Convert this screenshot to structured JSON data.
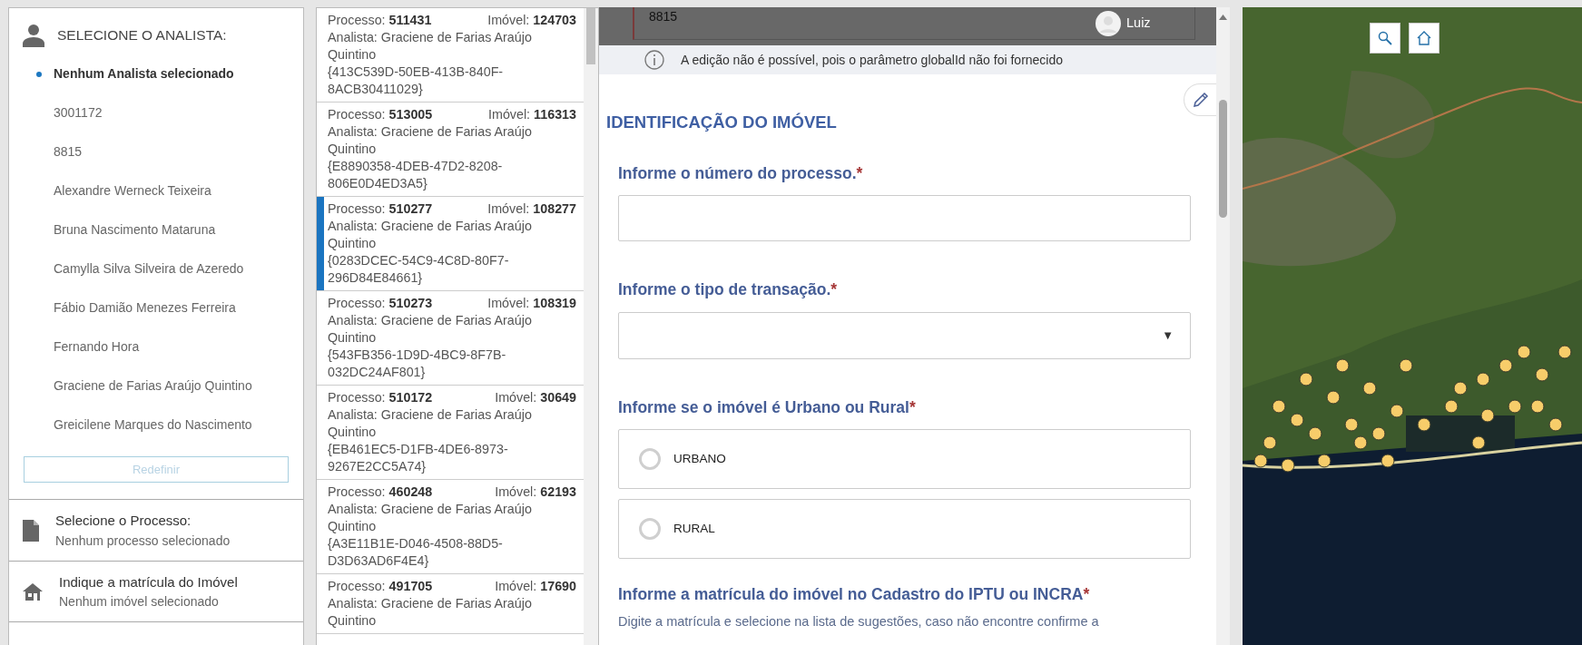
{
  "analyst_panel": {
    "title": "SELECIONE O ANALISTA:",
    "options": [
      {
        "label": "Nenhum Analista selecionado",
        "selected": true
      },
      {
        "label": "3001172",
        "selected": false
      },
      {
        "label": "8815",
        "selected": false
      },
      {
        "label": "Alexandre Werneck Teixeira",
        "selected": false
      },
      {
        "label": "Bruna Nascimento Mataruna",
        "selected": false
      },
      {
        "label": "Camylla Silva Silveira de Azeredo",
        "selected": false
      },
      {
        "label": "Fábio Damião Menezes Ferreira",
        "selected": false
      },
      {
        "label": "Fernando Hora",
        "selected": false
      },
      {
        "label": "Graciene de Farias Araújo Quintino",
        "selected": false
      },
      {
        "label": "Greicilene Marques do Nascimento",
        "selected": false
      }
    ],
    "reset_button": {
      "label": "Redefinir",
      "disabled": true
    }
  },
  "steps": [
    {
      "kind": "document",
      "title": "Selecione o Processo:",
      "subtitle": "Nenhum processo selecionado"
    },
    {
      "kind": "house",
      "title": "Indique a matrícula do Imóvel",
      "subtitle": "Nenhum imóvel selecionado"
    }
  ],
  "process_list": [
    {
      "processo_label": "Processo:",
      "processo": "511431",
      "imovel_label": "Imóvel:",
      "imovel": "124703",
      "analista": "Analista: Graciene de Farias Araújo Quintino",
      "global_id": "{413C539D-50EB-413B-840F-8ACB30411029}",
      "selected": false
    },
    {
      "processo_label": "Processo:",
      "processo": "513005",
      "imovel_label": "Imóvel:",
      "imovel": "116313",
      "analista": "Analista: Graciene de Farias Araújo Quintino",
      "global_id": "{E8890358-4DEB-47D2-8208-806E0D4ED3A5}",
      "selected": false
    },
    {
      "processo_label": "Processo:",
      "processo": "510277",
      "imovel_label": "Imóvel:",
      "imovel": "108277",
      "analista": "Analista: Graciene de Farias Araújo Quintino",
      "global_id": "{0283DCEC-54C9-4C8D-80F7-296D84E84661}",
      "selected": true
    },
    {
      "processo_label": "Processo:",
      "processo": "510273",
      "imovel_label": "Imóvel:",
      "imovel": "108319",
      "analista": "Analista: Graciene de Farias Araújo Quintino",
      "global_id": "{543FB356-1D9D-4BC9-8F7B-032DC24AF801}",
      "selected": false
    },
    {
      "processo_label": "Processo:",
      "processo": "510172",
      "imovel_label": "Imóvel:",
      "imovel": "30649",
      "analista": "Analista: Graciene de Farias Araújo Quintino",
      "global_id": "{EB461EC5-D1FB-4DE6-8973-9267E2CC5A74}",
      "selected": false
    },
    {
      "processo_label": "Processo:",
      "processo": "460248",
      "imovel_label": "Imóvel:",
      "imovel": "62193",
      "analista": "Analista: Graciene de Farias Araújo Quintino",
      "global_id": "{A3E11B1E-D046-4508-88D5-D3D63AD6F4E4}",
      "selected": false
    },
    {
      "processo_label": "Processo:",
      "processo": "491705",
      "imovel_label": "Imóvel:",
      "imovel": "17690",
      "analista": "Analista: Graciene de Farias Araújo Quintino",
      "selected": false
    }
  ],
  "form": {
    "header_value": "8815",
    "user": "Luiz",
    "notice": "A edição não é possível, pois o parâmetro globalId não foi fornecido",
    "section_title": "IDENTIFICAÇÃO DO IMÓVEL",
    "questions": [
      {
        "kind": "text",
        "label": "Informe o número do processo.",
        "required_mark": "*"
      },
      {
        "kind": "select",
        "label": "Informe o tipo de transação.",
        "required_mark": "*",
        "caret": "▼"
      },
      {
        "kind": "radio",
        "label": "Informe se o imóvel é Urbano ou Rural",
        "required_mark": "*",
        "options": [
          {
            "label": "URBANO",
            "selected": false
          },
          {
            "label": "RURAL",
            "selected": false
          }
        ]
      },
      {
        "kind": "hint",
        "label": "Informe a matrícula do imóvel no Cadastro do IPTU ou INCRA",
        "required_mark": "*",
        "hint": "Digite a matrícula e selecione na lista de sugestões, caso não encontre confirme a"
      }
    ]
  }
}
